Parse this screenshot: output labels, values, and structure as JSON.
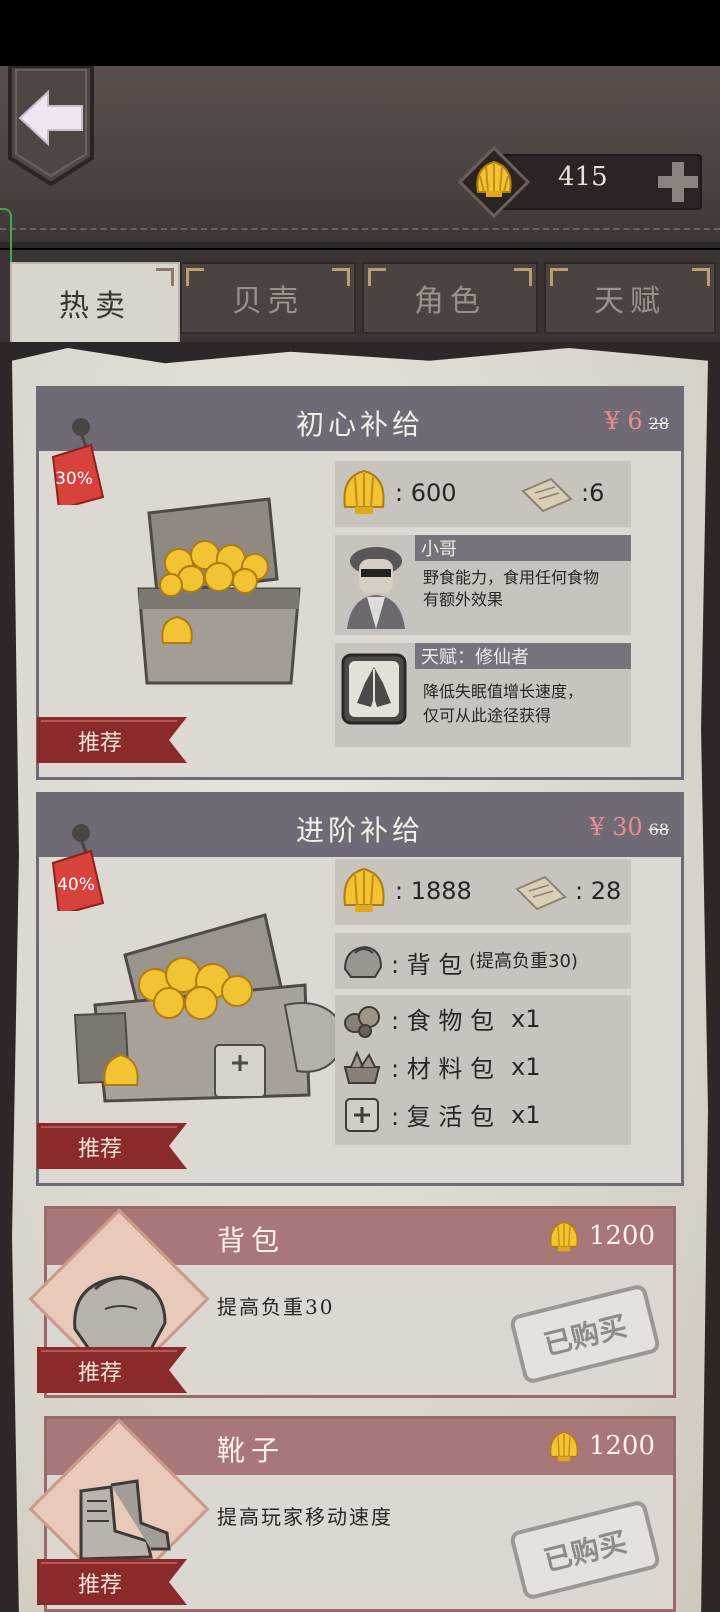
{
  "header": {
    "coin_count": "415"
  },
  "tabs": [
    {
      "label": "热卖",
      "active": true
    },
    {
      "label": "贝壳",
      "active": false
    },
    {
      "label": "角色",
      "active": false
    },
    {
      "label": "天赋",
      "active": false
    }
  ],
  "bundles": [
    {
      "title": "初心补给",
      "price": "¥ 6",
      "old_price": "28",
      "discount": "30%",
      "ribbon": "推荐",
      "shells": ": 600",
      "tickets": ":6",
      "character_name": "小哥",
      "character_desc_1": "野食能力，食用任何食物",
      "character_desc_2": "有额外效果",
      "talent_name": "天赋：修仙者",
      "talent_desc_1": "降低失眠值增长速度，",
      "talent_desc_2": "仅可从此途径获得"
    },
    {
      "title": "进阶补给",
      "price": "¥ 30",
      "old_price": "68",
      "discount": "40%",
      "ribbon": "推荐",
      "shells": ": 1888",
      "tickets": ": 28",
      "backpack_label": ": 背 包",
      "backpack_note": "(提高负重30)",
      "items": [
        {
          "label": ": 食 物 包",
          "qty": "x1"
        },
        {
          "label": ": 材 料 包",
          "qty": "x1"
        },
        {
          "label": ": 复 活 包",
          "qty": "x1"
        }
      ]
    }
  ],
  "items": [
    {
      "title": "背包",
      "price": "1200",
      "desc": "提高负重30",
      "status": "已购买",
      "ribbon": "推荐"
    },
    {
      "title": "靴子",
      "price": "1200",
      "desc": "提高玩家移动速度",
      "status": "已购买",
      "ribbon": "推荐"
    }
  ],
  "colors": {
    "accent_price": "#ea8d8f",
    "card_head": "#6f6a75",
    "item_head": "#a87777",
    "ribbon": "#8a2a2a",
    "gold": "#e5b325"
  }
}
